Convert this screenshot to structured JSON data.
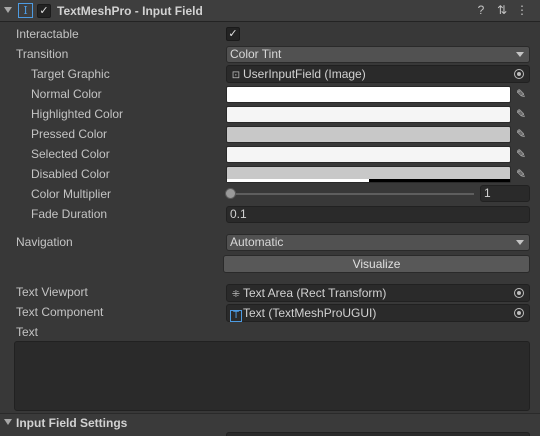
{
  "header": {
    "icon_glyph": "I",
    "enabled_check": "✓",
    "title": "TextMeshPro - Input Field",
    "help_glyph": "?",
    "preset_glyph": "⇅",
    "menu_glyph": "⋮"
  },
  "fields": {
    "interactable": {
      "label": "Interactable",
      "check": "✓"
    },
    "transition": {
      "label": "Transition",
      "value": "Color Tint"
    },
    "target_graphic": {
      "label": "Target Graphic",
      "type_glyph": "⊡",
      "value": "UserInputField (Image)"
    },
    "normal_color": {
      "label": "Normal Color",
      "color": "#ffffff"
    },
    "highlighted_color": {
      "label": "Highlighted Color",
      "color": "#f5f5f5"
    },
    "pressed_color": {
      "label": "Pressed Color",
      "color": "#c8c8c8"
    },
    "selected_color": {
      "label": "Selected Color",
      "color": "#f5f5f5"
    },
    "disabled_color": {
      "label": "Disabled Color",
      "color": "#c8c8c8",
      "alpha": 0.5
    },
    "color_multiplier": {
      "label": "Color Multiplier",
      "value": "1",
      "slider_fraction": 0.0
    },
    "fade_duration": {
      "label": "Fade Duration",
      "value": "0.1"
    },
    "navigation": {
      "label": "Navigation",
      "value": "Automatic",
      "visualize_label": "Visualize"
    },
    "text_viewport": {
      "label": "Text Viewport",
      "type_glyph": "⁜",
      "value": "Text Area (Rect Transform)"
    },
    "text_component": {
      "label": "Text Component",
      "type_glyph": "T",
      "value": "Text (TextMeshProUGUI)"
    },
    "text": {
      "label": "Text",
      "value": ""
    }
  },
  "eyedropper_glyph": "✎",
  "section": {
    "title": "Input Field Settings"
  },
  "colors": {
    "accent": "#4d9be2",
    "panel_bg": "#383838"
  }
}
